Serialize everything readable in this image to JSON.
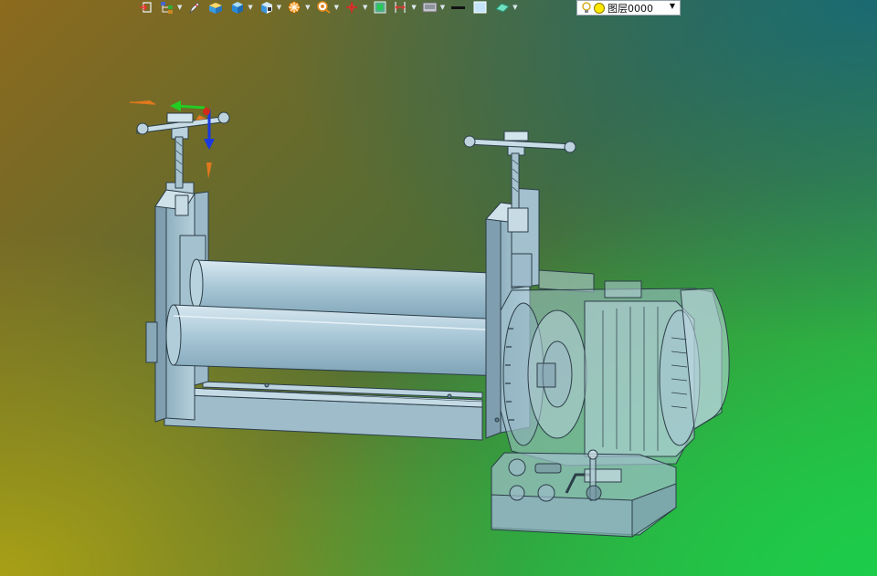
{
  "toolbar": {
    "icons": [
      "import-icon",
      "tree-icon",
      "pen-icon",
      "solid-box-icon",
      "view-cube-icon",
      "section-view-icon",
      "render-icon",
      "zoom-icon",
      "axis-icon",
      "frame-icon",
      "measure-icon",
      "display-mode-icon",
      "line-style-icon",
      "color-swatch-icon",
      "eraser-icon"
    ]
  },
  "layer_selector": {
    "value": "图层0000"
  },
  "viewport": {
    "model": "sheet-metal-roller-machine",
    "colors": {
      "body": "#a9c8d6",
      "edge": "#2c3e48",
      "triad_x": "#22cc22",
      "triad_z": "#1a3adf",
      "triad_origin": "#d02a1a",
      "manip_handle": "#e0781e"
    }
  }
}
